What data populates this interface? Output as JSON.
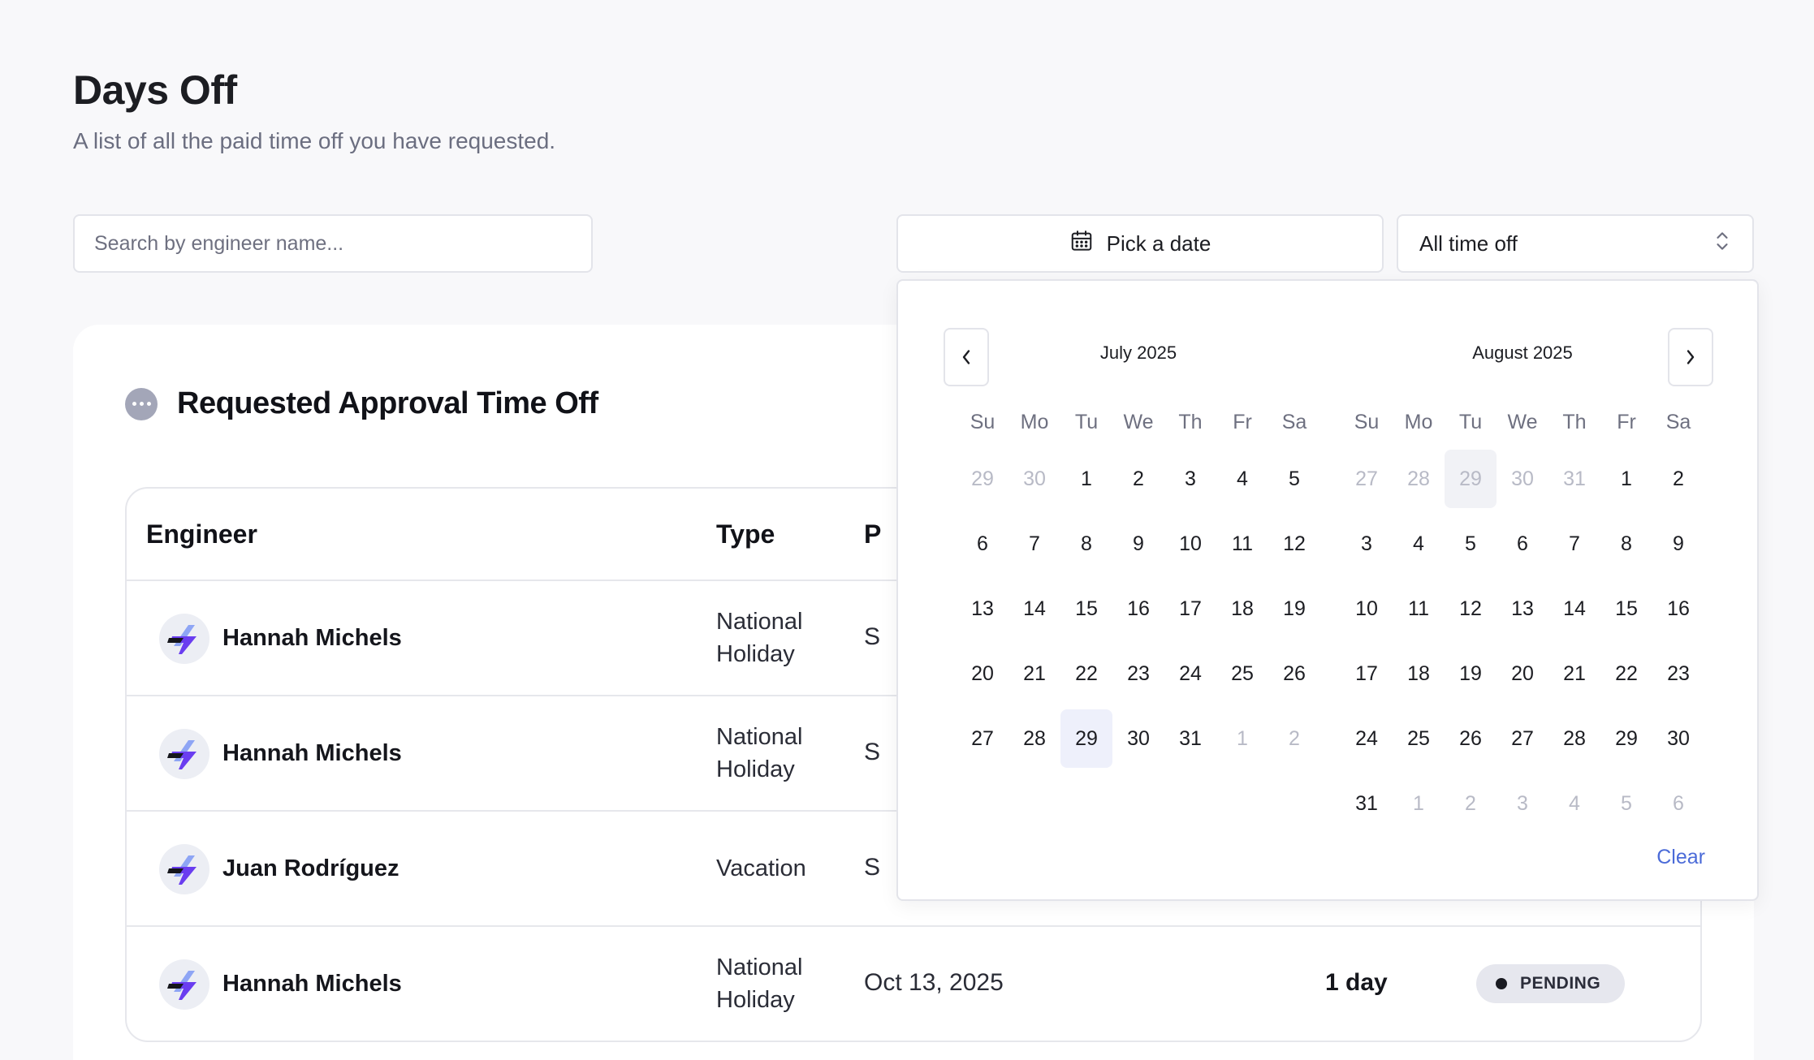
{
  "header": {
    "title": "Days Off",
    "subtitle": "A list of all the paid time off you have requested."
  },
  "filters": {
    "search_placeholder": "Search by engineer name...",
    "date_button_label": "Pick a date",
    "type_select_value": "All time off"
  },
  "section": {
    "title": "Requested Approval Time Off"
  },
  "table": {
    "columns": [
      "Engineer",
      "Type",
      "P"
    ],
    "rows": [
      {
        "engineer": "Hannah Michels",
        "type_line1": "National",
        "type_line2": "Holiday",
        "period": "S",
        "duration": "",
        "status": ""
      },
      {
        "engineer": "Hannah Michels",
        "type_line1": "National",
        "type_line2": "Holiday",
        "period": "S",
        "duration": "",
        "status": ""
      },
      {
        "engineer": "Juan Rodríguez",
        "type_line1": "Vacation",
        "type_line2": "",
        "period": "S",
        "duration": "",
        "status": ""
      },
      {
        "engineer": "Hannah Michels",
        "type_line1": "National",
        "type_line2": "Holiday",
        "period": "Oct 13, 2025",
        "duration": "1 day",
        "status": "PENDING"
      }
    ]
  },
  "calendar": {
    "weekdays": [
      "Su",
      "Mo",
      "Tu",
      "We",
      "Th",
      "Fr",
      "Sa"
    ],
    "months": [
      {
        "caption": "July 2025",
        "days": [
          {
            "d": "29",
            "out": true
          },
          {
            "d": "30",
            "out": true
          },
          {
            "d": "1"
          },
          {
            "d": "2"
          },
          {
            "d": "3"
          },
          {
            "d": "4"
          },
          {
            "d": "5"
          },
          {
            "d": "6"
          },
          {
            "d": "7"
          },
          {
            "d": "8"
          },
          {
            "d": "9"
          },
          {
            "d": "10"
          },
          {
            "d": "11"
          },
          {
            "d": "12"
          },
          {
            "d": "13"
          },
          {
            "d": "14"
          },
          {
            "d": "15"
          },
          {
            "d": "16"
          },
          {
            "d": "17"
          },
          {
            "d": "18"
          },
          {
            "d": "19"
          },
          {
            "d": "20"
          },
          {
            "d": "21"
          },
          {
            "d": "22"
          },
          {
            "d": "23"
          },
          {
            "d": "24"
          },
          {
            "d": "25"
          },
          {
            "d": "26"
          },
          {
            "d": "27"
          },
          {
            "d": "28"
          },
          {
            "d": "29",
            "selected": true
          },
          {
            "d": "30"
          },
          {
            "d": "31"
          },
          {
            "d": "1",
            "out": true
          },
          {
            "d": "2",
            "out": true
          }
        ]
      },
      {
        "caption": "August 2025",
        "days": [
          {
            "d": "27",
            "out": true
          },
          {
            "d": "28",
            "out": true
          },
          {
            "d": "29",
            "out": true,
            "highlight": true
          },
          {
            "d": "30",
            "out": true
          },
          {
            "d": "31",
            "out": true
          },
          {
            "d": "1"
          },
          {
            "d": "2"
          },
          {
            "d": "3"
          },
          {
            "d": "4"
          },
          {
            "d": "5"
          },
          {
            "d": "6"
          },
          {
            "d": "7"
          },
          {
            "d": "8"
          },
          {
            "d": "9"
          },
          {
            "d": "10"
          },
          {
            "d": "11"
          },
          {
            "d": "12"
          },
          {
            "d": "13"
          },
          {
            "d": "14"
          },
          {
            "d": "15"
          },
          {
            "d": "16"
          },
          {
            "d": "17"
          },
          {
            "d": "18"
          },
          {
            "d": "19"
          },
          {
            "d": "20"
          },
          {
            "d": "21"
          },
          {
            "d": "22"
          },
          {
            "d": "23"
          },
          {
            "d": "24"
          },
          {
            "d": "25"
          },
          {
            "d": "26"
          },
          {
            "d": "27"
          },
          {
            "d": "28"
          },
          {
            "d": "29"
          },
          {
            "d": "30"
          },
          {
            "d": "31"
          },
          {
            "d": "1",
            "out": true
          },
          {
            "d": "2",
            "out": true
          },
          {
            "d": "3",
            "out": true
          },
          {
            "d": "4",
            "out": true
          },
          {
            "d": "5",
            "out": true
          },
          {
            "d": "6",
            "out": true
          }
        ]
      }
    ],
    "clear_label": "Clear"
  },
  "colors": {
    "accent": "#4b6bd8",
    "avatar_purple": "#6a3df0",
    "avatar_blue": "#8ea5f5",
    "badge_bg": "#e6e7ee"
  },
  "icons": [
    "calendar-icon",
    "chevron-up-down-icon",
    "more-dots-icon",
    "chevron-left-icon",
    "chevron-right-icon",
    "engineer-logo-icon"
  ]
}
